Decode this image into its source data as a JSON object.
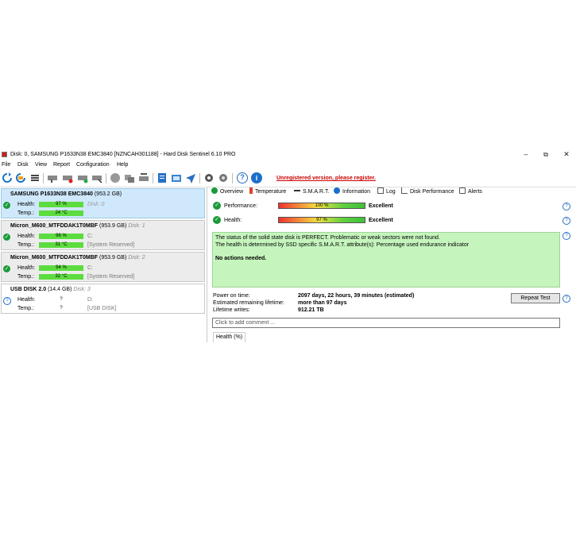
{
  "window": {
    "title": "Disk: 0, SAMSUNG P1633N38 EMC3840 [NZNCAH301188]  -  Hard Disk Sentinel 6.10 PRO",
    "controls": [
      "minimize",
      "maximize",
      "close"
    ]
  },
  "menu": [
    "File",
    "Disk",
    "View",
    "Report",
    "Configuration",
    "Help"
  ],
  "toolbar": {
    "icons": [
      "refresh-icon",
      "refresh-all-icon",
      "menu-list-icon",
      "disk-test-icon",
      "disk-surface-icon",
      "disk-settings-icon",
      "disk-erase-icon",
      "disk-gray-icon",
      "disk-copy-icon",
      "disk-reinitialize-icon",
      "notes-icon",
      "drive-info-icon",
      "send-report-icon",
      "configuration-gear-icon",
      "alerts-gear-icon",
      "help-icon",
      "info-icon"
    ],
    "unregistered": "Unregistered version, please register."
  },
  "disks": [
    {
      "name": "SAMSUNG P1633N38 EMC3840",
      "size": "(953.2 GB)",
      "disk": "Disk: 0",
      "health_label": "Health:",
      "health": "97 %",
      "health_fraction": 0.97,
      "temp_label": "Temp.:",
      "temp": "24 °C",
      "drive": "",
      "note": "",
      "status": "ok"
    },
    {
      "name": "Micron_M600_MTFDDAK1T0MBF",
      "size": "(953.9 GB)",
      "disk": "Disk: 1",
      "health_label": "Health:",
      "health": "96 %",
      "health_fraction": 0.96,
      "temp_label": "Temp.:",
      "temp": "31 °C",
      "drive": "C:",
      "note": "[System Reserved]",
      "status": "ok"
    },
    {
      "name": "Micron_M600_MTFDDAK1T0MBF",
      "size": "(953.9 GB)",
      "disk": "Disk: 2",
      "health_label": "Health:",
      "health": "94 %",
      "health_fraction": 0.94,
      "temp_label": "Temp.:",
      "temp": "32 °C",
      "drive": "C:",
      "note": "[System Reserved]",
      "status": "ok"
    },
    {
      "name": "USB DISK 2.0",
      "size": "(14.4 GB)",
      "disk": "Disk: 3",
      "health_label": "Health:",
      "health": "?",
      "temp_label": "Temp.:",
      "temp": "?",
      "drive": "D:",
      "note": "[USB DISK]",
      "status": "unknown"
    }
  ],
  "tabs": [
    "Overview",
    "Temperature",
    "S.M.A.R.T.",
    "Information",
    "Log",
    "Disk Performance",
    "Alerts"
  ],
  "overview": {
    "performance_label": "Performance:",
    "performance_value": "100 %",
    "performance_fraction": 1.0,
    "performance_grade": "Excellent",
    "health_label": "Health:",
    "health_value": "97 %",
    "health_fraction": 0.97,
    "health_grade": "Excellent",
    "status_line1": "The status of the solid state disk is PERFECT. Problematic or weak sectors were not found.",
    "status_line2": "The health is determined by SSD specific S.M.A.R.T. attribute(s):  Percentage used endurance indicator",
    "actions": "No actions needed.",
    "power_on_label": "Power on time:",
    "power_on_value": "2097 days, 22 hours, 39 minutes (estimated)",
    "remaining_label": "Estimated remaining lifetime:",
    "remaining_value": "more than 97 days",
    "writes_label": "Lifetime writes:",
    "writes_value": "912.21 TB",
    "repeat_button": "Repeat Test",
    "comment_placeholder": "Click to add comment ...",
    "health_tab": "Health (%)"
  },
  "colors": {
    "accent_red": "#cc0000",
    "ok_green": "#1b9a3a",
    "status_bg": "#c5f5bd",
    "selected_bg": "#cfe8fb"
  }
}
